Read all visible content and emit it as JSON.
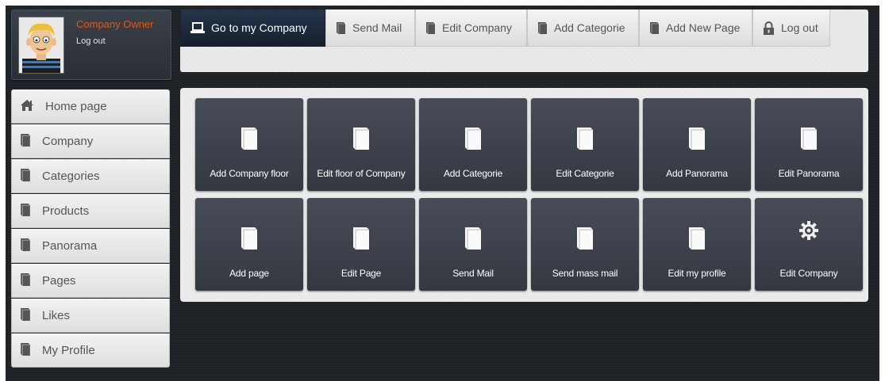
{
  "profile": {
    "name": "Company Owner",
    "logout_label": "Log out"
  },
  "topbar": {
    "buttons": [
      {
        "label": "Go to my Company",
        "icon": "laptop-icon"
      },
      {
        "label": "Send Mail",
        "icon": "document-icon"
      },
      {
        "label": "Edit Company",
        "icon": "document-icon"
      },
      {
        "label": "Add Categorie",
        "icon": "document-icon"
      },
      {
        "label": "Add New Page",
        "icon": "document-icon"
      },
      {
        "label": "Log out",
        "icon": "lock-icon"
      }
    ]
  },
  "sidebar": {
    "items": [
      {
        "label": "Home page",
        "icon": "home-icon"
      },
      {
        "label": "Company",
        "icon": "document-icon"
      },
      {
        "label": "Categories",
        "icon": "document-icon"
      },
      {
        "label": "Products",
        "icon": "document-icon"
      },
      {
        "label": "Panorama",
        "icon": "document-icon"
      },
      {
        "label": "Pages",
        "icon": "document-icon"
      },
      {
        "label": "Likes",
        "icon": "document-icon"
      },
      {
        "label": "My Profile",
        "icon": "document-icon"
      }
    ]
  },
  "tiles": [
    {
      "label": "Add Company floor",
      "icon": "page-icon"
    },
    {
      "label": "Edit floor of Company",
      "icon": "page-icon"
    },
    {
      "label": "Add Categorie",
      "icon": "page-icon"
    },
    {
      "label": "Edit Categorie",
      "icon": "page-icon"
    },
    {
      "label": "Add Panorama",
      "icon": "page-icon"
    },
    {
      "label": "Edit Panorama",
      "icon": "page-icon"
    },
    {
      "label": "Add page",
      "icon": "page-icon"
    },
    {
      "label": "Edit Page",
      "icon": "page-icon"
    },
    {
      "label": "Send Mail",
      "icon": "page-icon"
    },
    {
      "label": "Send mass mail",
      "icon": "page-icon"
    },
    {
      "label": "Edit my profile",
      "icon": "page-icon"
    },
    {
      "label": "Edit Company",
      "icon": "gear-icon"
    }
  ],
  "colors": {
    "accent_name": "#e0581c",
    "active_tab": "#1c2838",
    "tile_bg": "#3d414a",
    "frame_bg": "#1d2025"
  }
}
